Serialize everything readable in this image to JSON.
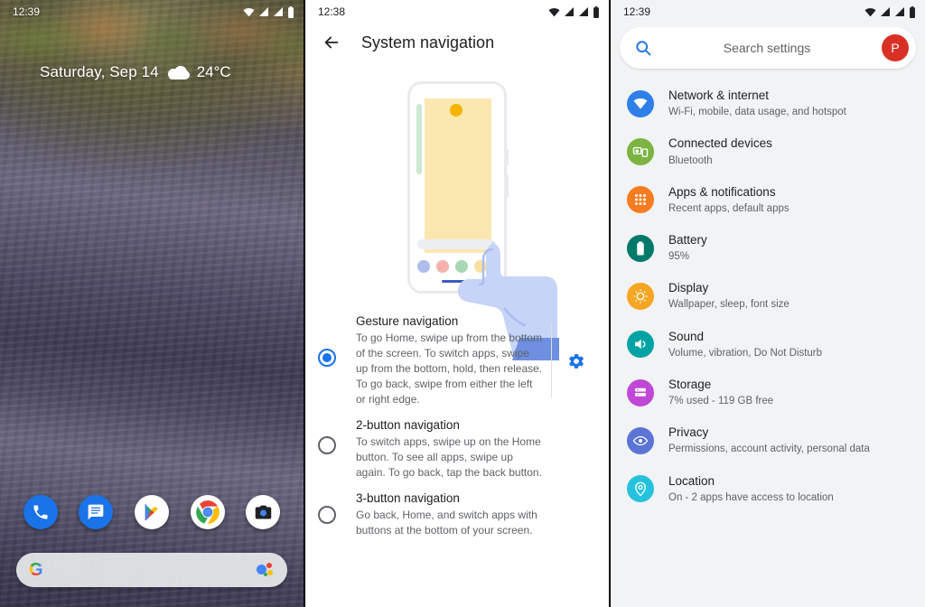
{
  "home": {
    "status": {
      "time": "12:39",
      "icons": [
        "wifi-icon",
        "signal-icon",
        "signal-icon",
        "battery-icon"
      ]
    },
    "widget": {
      "date": "Saturday, Sep 14",
      "weather_icon": "cloud-icon",
      "temperature": "24°C"
    },
    "dock": [
      {
        "name": "phone",
        "label": "Phone"
      },
      {
        "name": "messages",
        "label": "Messages"
      },
      {
        "name": "play-store",
        "label": "Play Store"
      },
      {
        "name": "chrome",
        "label": "Chrome"
      },
      {
        "name": "camera",
        "label": "Camera"
      }
    ],
    "search_pill": {
      "logo": "google-g-logo",
      "assistant_icon": "assistant-icon"
    }
  },
  "navigation": {
    "status": {
      "time": "12:38"
    },
    "appbar": {
      "back_icon": "back-arrow-icon",
      "title": "System navigation"
    },
    "illustration": {
      "name": "gesture-navigation-illustration",
      "dot_colors": [
        "#aebdea",
        "#f3b3ac",
        "#a8d8b4",
        "#f7dfa0"
      ],
      "card_color": "#fbe7b0",
      "accent_dot": "#f5b400"
    },
    "options": [
      {
        "title": "Gesture navigation",
        "description": "To go Home, swipe up from the bottom of the screen. To switch apps, swipe up from the bottom, hold, then release. To go back, swipe from either the left or right edge.",
        "selected": true,
        "has_settings": true,
        "settings_icon": "gear-icon"
      },
      {
        "title": "2-button navigation",
        "description": "To switch apps, swipe up on the Home button. To see all apps, swipe up again. To go back, tap the back button.",
        "selected": false,
        "has_settings": false
      },
      {
        "title": "3-button navigation",
        "description": "Go back, Home, and switch apps with buttons at the bottom of your screen.",
        "selected": false,
        "has_settings": false
      }
    ]
  },
  "settings": {
    "status": {
      "time": "12:39"
    },
    "search": {
      "icon": "search-icon",
      "placeholder": "Search settings",
      "avatar_letter": "P",
      "avatar_color": "#d93025"
    },
    "items": [
      {
        "icon": "wifi-icon",
        "color": "#2e7fe8",
        "title": "Network & internet",
        "subtitle": "Wi-Fi, mobile, data usage, and hotspot"
      },
      {
        "icon": "connected-devices-icon",
        "color": "#7cb342",
        "title": "Connected devices",
        "subtitle": "Bluetooth"
      },
      {
        "icon": "apps-grid-icon",
        "color": "#f57c20",
        "title": "Apps & notifications",
        "subtitle": "Recent apps, default apps"
      },
      {
        "icon": "battery-icon",
        "color": "#00796b",
        "title": "Battery",
        "subtitle": "95%"
      },
      {
        "icon": "brightness-icon",
        "color": "#f5a623",
        "title": "Display",
        "subtitle": "Wallpaper, sleep, font size"
      },
      {
        "icon": "volume-icon",
        "color": "#00a3a3",
        "title": "Sound",
        "subtitle": "Volume, vibration, Do Not Disturb"
      },
      {
        "icon": "storage-icon",
        "color": "#c147d6",
        "title": "Storage",
        "subtitle": "7% used - 119 GB free"
      },
      {
        "icon": "privacy-eye-icon",
        "color": "#5b74d6",
        "title": "Privacy",
        "subtitle": "Permissions, account activity, personal data"
      },
      {
        "icon": "location-pin-icon",
        "color": "#25c2dd",
        "title": "Location",
        "subtitle": "On - 2 apps have access to location"
      }
    ]
  }
}
